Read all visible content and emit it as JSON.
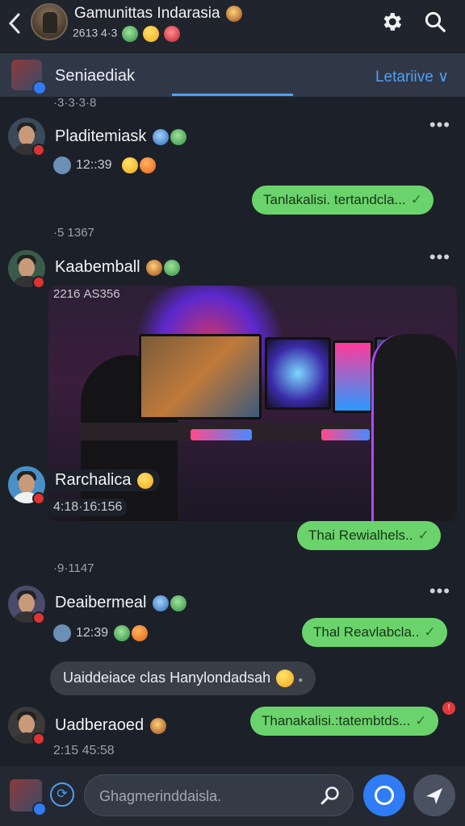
{
  "header": {
    "title": "Gamunittas Indarasia",
    "subtitle": "2613 4·3",
    "back_icon": "chevron-left-icon",
    "settings_icon": "gear-icon",
    "search_icon": "search-icon"
  },
  "tabbar": {
    "current": "Seniaediak",
    "right_label": "Letariive ∨"
  },
  "feed": {
    "ts_top": "·3·3·3·8",
    "msg1": {
      "name": "Pladitemiask",
      "time": "12::39"
    },
    "out1": {
      "text": "Tanlakalisi. tertandcla...",
      "check": "✓"
    },
    "ts2": "·5 1367",
    "msg2": {
      "name": "Kaabemball",
      "photo_ts": "2216 AS356"
    },
    "msg3": {
      "name": "Rarchalica",
      "time": "4:18·16:156"
    },
    "out2": {
      "text": "Thai Rewialhels..",
      "check": "✓"
    },
    "ts3": "·9·1147",
    "msg4": {
      "name": "Deaibermeal",
      "time": "12:39"
    },
    "out3": {
      "text": "Thal Reavlabcla..",
      "check": "✓"
    },
    "in1": {
      "text": "Uaiddeiace clas Hanylondadsah"
    },
    "msg5": {
      "name": "Uadberaoed",
      "time": "2:15 45:58"
    },
    "out4": {
      "text": "Thanakalisi.:tatembtds...",
      "check": "✓",
      "error": "!"
    }
  },
  "composer": {
    "placeholder": "Ghagmerinddaisla."
  }
}
